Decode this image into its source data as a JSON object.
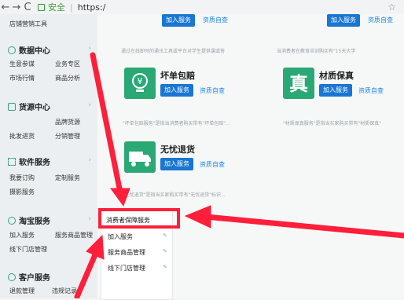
{
  "browser": {
    "nav_back": "←",
    "nav_forward": "→",
    "nav_reload": "C",
    "secure": "安全",
    "url": "https:/",
    "star": "☆"
  },
  "sidebar": {
    "top_item": "店铺营销工具",
    "sections": [
      {
        "title": "数据中心",
        "items": [
          "生意参谋",
          "业务专区",
          "市场行情",
          "商品分析"
        ]
      },
      {
        "title": "货源中心",
        "items": [
          "品牌货源",
          "批发进货",
          "分销管理"
        ]
      },
      {
        "title": "软件服务",
        "items": [
          "我要订购",
          "定制服务",
          "摄影服务"
        ]
      },
      {
        "title": "淘宝服务",
        "items": [
          "加入服务",
          "服务商品管理",
          "线下门店管理"
        ]
      },
      {
        "title": "客户服务",
        "items": [
          "退款管理",
          "违规记录"
        ]
      }
    ]
  },
  "cards": {
    "top_left": {
      "add_label": "加入服务",
      "qual_label": "资质自查",
      "desc": "通过在线即时的通讯工具或平台对学生提供课或答"
    },
    "top_right": {
      "add_label": "加入服务",
      "qual_label": "资质自查",
      "desc": "当消费者在教育培训购买有\"15天大学"
    },
    "bad_pack": {
      "title": "坏单包赔",
      "add_label": "加入服务",
      "qual_label": "资质自查",
      "desc": "\"坏单包赔服务\"是指当消费者购买带有\"坏单包赔\"..."
    },
    "material": {
      "title": "材质保真",
      "add_label": "加入服务",
      "qual_label": "资质自查",
      "desc": "\"材质保真服务\"是指当买家购买带有\"材质保真\""
    },
    "no_worry": {
      "title": "无忧退货",
      "add_label": "加入服务",
      "qual_label": "资质自查",
      "desc": "\"无忧退货\"是指当买家购买带有\"无忧退货\"标识..."
    }
  },
  "submenu": {
    "header": "消费者保障服务",
    "items": [
      "加入服务",
      "服务商品管理",
      "线下门店管理"
    ]
  },
  "icons": {
    "back": "back-arrow-icon",
    "forward": "forward-arrow-icon",
    "reload": "reload-icon",
    "lock": "lock-icon",
    "data_center": "data-center-icon",
    "supply": "supply-icon",
    "software": "software-icon",
    "taobao_service": "service-icon",
    "customer": "customer-icon",
    "pin": "pin-icon"
  },
  "colors": {
    "accent_blue": "#1976d2",
    "green": "#2aa876",
    "annotation_red": "#ff1f3a"
  }
}
